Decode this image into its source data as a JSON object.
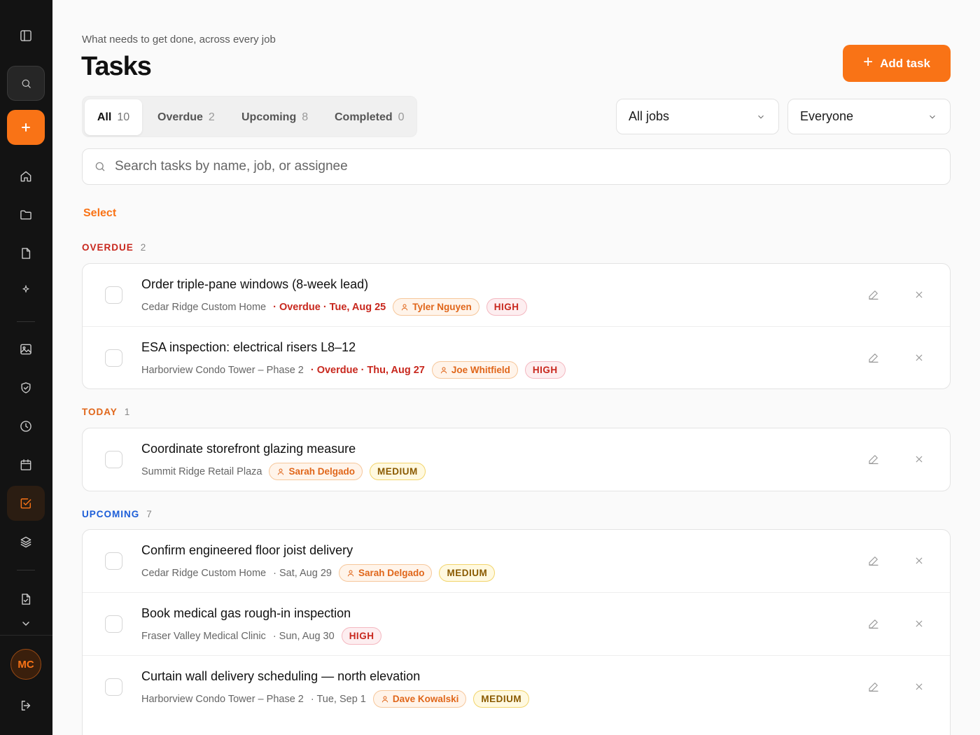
{
  "header": {
    "subtitle": "What needs to get done, across every job",
    "title": "Tasks",
    "add_label": "Add task"
  },
  "sidebar": {
    "avatar_initials": "MC",
    "icons": [
      "sidebar-toggle-icon",
      "search-icon",
      "plus-icon",
      "home-icon",
      "folder-icon",
      "document-icon",
      "sparkle-icon",
      "image-icon",
      "shield-check-icon",
      "clock-icon",
      "calendar-icon",
      "checkbox-icon",
      "layers-icon",
      "file-check-icon",
      "chevron-down-icon",
      "logout-icon"
    ],
    "active": "checkbox-icon"
  },
  "tabs": [
    {
      "label": "All",
      "count": "10"
    },
    {
      "label": "Overdue",
      "count": "2"
    },
    {
      "label": "Upcoming",
      "count": "8"
    },
    {
      "label": "Completed",
      "count": "0"
    }
  ],
  "filters": {
    "jobs": "All jobs",
    "assignee": "Everyone"
  },
  "search": {
    "placeholder": "Search tasks by name, job, or assignee"
  },
  "select_label": "Select",
  "sections": [
    {
      "label": "OVERDUE",
      "count": "2",
      "tasks": [
        {
          "title": "Order triple-pane windows (8-week lead)",
          "job": "Cedar Ridge Custom Home",
          "due": "· Overdue · Tue, Aug 25",
          "assignee": "Tyler Nguyen",
          "priority": "HIGH"
        },
        {
          "title": "ESA inspection: electrical risers L8–12",
          "job": "Harborview Condo Tower – Phase 2",
          "due": "· Overdue · Thu, Aug 27",
          "assignee": "Joe Whitfield",
          "priority": "HIGH"
        }
      ]
    },
    {
      "label": "TODAY",
      "count": "1",
      "tasks": [
        {
          "title": "Coordinate storefront glazing measure",
          "job": "Summit Ridge Retail Plaza",
          "assignee": "Sarah Delgado",
          "priority": "MEDIUM"
        }
      ]
    },
    {
      "label": "UPCOMING",
      "count": "7",
      "tasks": [
        {
          "title": "Confirm engineered floor joist delivery",
          "job": "Cedar Ridge Custom Home",
          "due": "· Sat, Aug 29",
          "assignee": "Sarah Delgado",
          "priority": "MEDIUM"
        },
        {
          "title": "Book medical gas rough-in inspection",
          "job": "Fraser Valley Medical Clinic",
          "due": "· Sun, Aug 30",
          "priority": "HIGH"
        },
        {
          "title": "Curtain wall delivery scheduling — north elevation",
          "job": "Harborview Condo Tower – Phase 2",
          "due": "· Tue, Sep 1",
          "assignee": "Dave Kowalski",
          "priority": "MEDIUM"
        }
      ]
    }
  ],
  "colors": {
    "accent": "#f97316",
    "sidebar_bg": "#131313",
    "overdue": "#c8281e",
    "today": "#e0661a",
    "upcoming": "#1d5ed8"
  }
}
